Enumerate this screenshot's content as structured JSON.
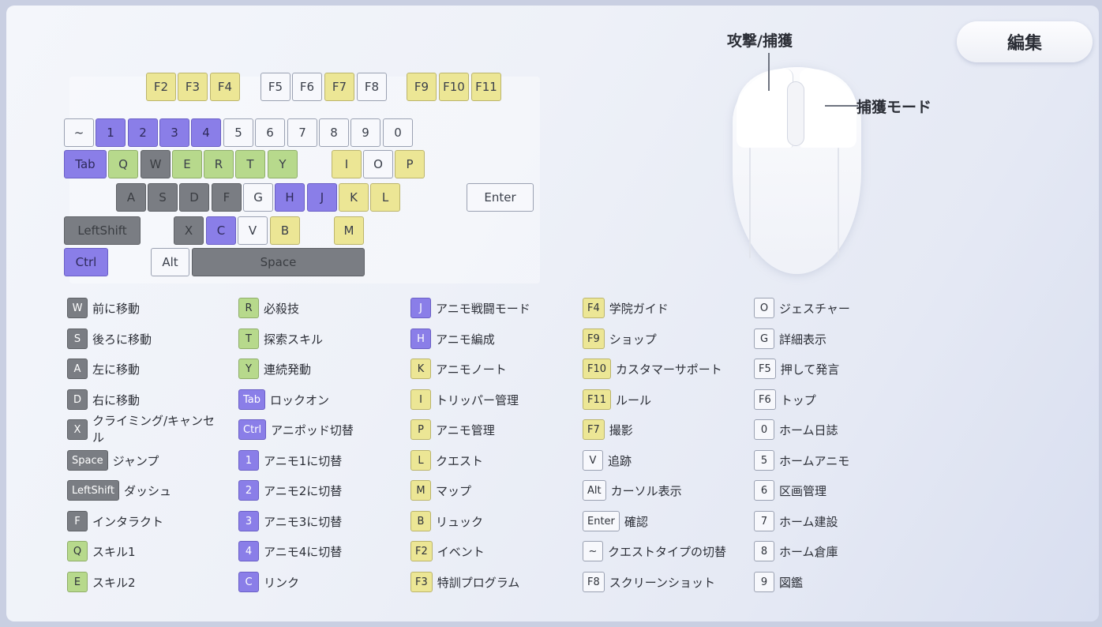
{
  "edit_button": "編集",
  "mouse": {
    "left_label": "攻撃/捕獲",
    "right_label": "捕獲モード"
  },
  "keyboard": {
    "keys": [
      {
        "label": "F2",
        "color": "yellow"
      },
      {
        "label": "F3",
        "color": "yellow"
      },
      {
        "label": "F4",
        "color": "yellow"
      },
      {
        "label": "F5",
        "color": "white"
      },
      {
        "label": "F6",
        "color": "white"
      },
      {
        "label": "F7",
        "color": "yellow"
      },
      {
        "label": "F8",
        "color": "white"
      },
      {
        "label": "F9",
        "color": "yellow"
      },
      {
        "label": "F10",
        "color": "yellow"
      },
      {
        "label": "F11",
        "color": "yellow"
      },
      {
        "label": "~",
        "color": "white"
      },
      {
        "label": "1",
        "color": "purple"
      },
      {
        "label": "2",
        "color": "purple"
      },
      {
        "label": "3",
        "color": "purple"
      },
      {
        "label": "4",
        "color": "purple"
      },
      {
        "label": "5",
        "color": "white"
      },
      {
        "label": "6",
        "color": "white"
      },
      {
        "label": "7",
        "color": "white"
      },
      {
        "label": "8",
        "color": "white"
      },
      {
        "label": "9",
        "color": "white"
      },
      {
        "label": "0",
        "color": "white"
      },
      {
        "label": "Tab",
        "color": "purple"
      },
      {
        "label": "Q",
        "color": "green"
      },
      {
        "label": "W",
        "color": "grey"
      },
      {
        "label": "E",
        "color": "green"
      },
      {
        "label": "R",
        "color": "green"
      },
      {
        "label": "T",
        "color": "green"
      },
      {
        "label": "Y",
        "color": "green"
      },
      {
        "label": "I",
        "color": "yellow"
      },
      {
        "label": "O",
        "color": "white"
      },
      {
        "label": "P",
        "color": "yellow"
      },
      {
        "label": "A",
        "color": "grey"
      },
      {
        "label": "S",
        "color": "grey"
      },
      {
        "label": "D",
        "color": "grey"
      },
      {
        "label": "F",
        "color": "grey"
      },
      {
        "label": "G",
        "color": "white"
      },
      {
        "label": "H",
        "color": "purple"
      },
      {
        "label": "J",
        "color": "purple"
      },
      {
        "label": "K",
        "color": "yellow"
      },
      {
        "label": "L",
        "color": "yellow"
      },
      {
        "label": "Enter",
        "color": "white"
      },
      {
        "label": "LeftShift",
        "color": "grey"
      },
      {
        "label": "X",
        "color": "grey"
      },
      {
        "label": "C",
        "color": "purple"
      },
      {
        "label": "V",
        "color": "white"
      },
      {
        "label": "B",
        "color": "yellow"
      },
      {
        "label": "M",
        "color": "yellow"
      },
      {
        "label": "Ctrl",
        "color": "purple"
      },
      {
        "label": "Alt",
        "color": "white"
      },
      {
        "label": "Space",
        "color": "grey"
      }
    ]
  },
  "legend": [
    {
      "key": "W",
      "color": "grey",
      "text": "前に移動"
    },
    {
      "key": "S",
      "color": "grey",
      "text": "後ろに移動"
    },
    {
      "key": "A",
      "color": "grey",
      "text": "左に移動"
    },
    {
      "key": "D",
      "color": "grey",
      "text": "右に移動"
    },
    {
      "key": "X",
      "color": "grey",
      "text": "クライミング/キャンセル"
    },
    {
      "key": "Space",
      "color": "grey",
      "text": "ジャンプ"
    },
    {
      "key": "LeftShift",
      "color": "grey",
      "text": "ダッシュ"
    },
    {
      "key": "F",
      "color": "grey",
      "text": "インタラクト"
    },
    {
      "key": "Q",
      "color": "green",
      "text": "スキル1"
    },
    {
      "key": "E",
      "color": "green",
      "text": "スキル2"
    },
    {
      "key": "R",
      "color": "green",
      "text": "必殺技"
    },
    {
      "key": "T",
      "color": "green",
      "text": "探索スキル"
    },
    {
      "key": "Y",
      "color": "green",
      "text": "連続発動"
    },
    {
      "key": "Tab",
      "color": "purple",
      "text": "ロックオン"
    },
    {
      "key": "Ctrl",
      "color": "purple",
      "text": "アニポッド切替"
    },
    {
      "key": "1",
      "color": "purple",
      "text": "アニモ1に切替"
    },
    {
      "key": "2",
      "color": "purple",
      "text": "アニモ2に切替"
    },
    {
      "key": "3",
      "color": "purple",
      "text": "アニモ3に切替"
    },
    {
      "key": "4",
      "color": "purple",
      "text": "アニモ4に切替"
    },
    {
      "key": "C",
      "color": "purple",
      "text": "リンク"
    },
    {
      "key": "J",
      "color": "purple",
      "text": "アニモ戦闘モード"
    },
    {
      "key": "H",
      "color": "purple",
      "text": "アニモ編成"
    },
    {
      "key": "K",
      "color": "yellow",
      "text": "アニモノート"
    },
    {
      "key": "I",
      "color": "yellow",
      "text": "トリッパー管理"
    },
    {
      "key": "P",
      "color": "yellow",
      "text": "アニモ管理"
    },
    {
      "key": "L",
      "color": "yellow",
      "text": "クエスト"
    },
    {
      "key": "M",
      "color": "yellow",
      "text": "マップ"
    },
    {
      "key": "B",
      "color": "yellow",
      "text": "リュック"
    },
    {
      "key": "F2",
      "color": "yellow",
      "text": "イベント"
    },
    {
      "key": "F3",
      "color": "yellow",
      "text": "特訓プログラム"
    },
    {
      "key": "F4",
      "color": "yellow",
      "text": "学院ガイド"
    },
    {
      "key": "F9",
      "color": "yellow",
      "text": "ショップ"
    },
    {
      "key": "F10",
      "color": "yellow",
      "text": "カスタマーサポート"
    },
    {
      "key": "F11",
      "color": "yellow",
      "text": "ルール"
    },
    {
      "key": "F7",
      "color": "yellow",
      "text": "撮影"
    },
    {
      "key": "V",
      "color": "white",
      "text": "追跡"
    },
    {
      "key": "Alt",
      "color": "white",
      "text": "カーソル表示"
    },
    {
      "key": "Enter",
      "color": "white",
      "text": "確認"
    },
    {
      "key": "~",
      "color": "white",
      "text": "クエストタイプの切替"
    },
    {
      "key": "F8",
      "color": "white",
      "text": "スクリーンショット"
    },
    {
      "key": "O",
      "color": "white",
      "text": "ジェスチャー"
    },
    {
      "key": "G",
      "color": "white",
      "text": "詳細表示"
    },
    {
      "key": "F5",
      "color": "white",
      "text": "押して発言"
    },
    {
      "key": "F6",
      "color": "white",
      "text": "トップ"
    },
    {
      "key": "0",
      "color": "white",
      "text": "ホーム日誌"
    },
    {
      "key": "5",
      "color": "white",
      "text": "ホームアニモ"
    },
    {
      "key": "6",
      "color": "white",
      "text": "区画管理"
    },
    {
      "key": "7",
      "color": "white",
      "text": "ホーム建設"
    },
    {
      "key": "8",
      "color": "white",
      "text": "ホーム倉庫"
    },
    {
      "key": "9",
      "color": "white",
      "text": "図鑑"
    }
  ]
}
